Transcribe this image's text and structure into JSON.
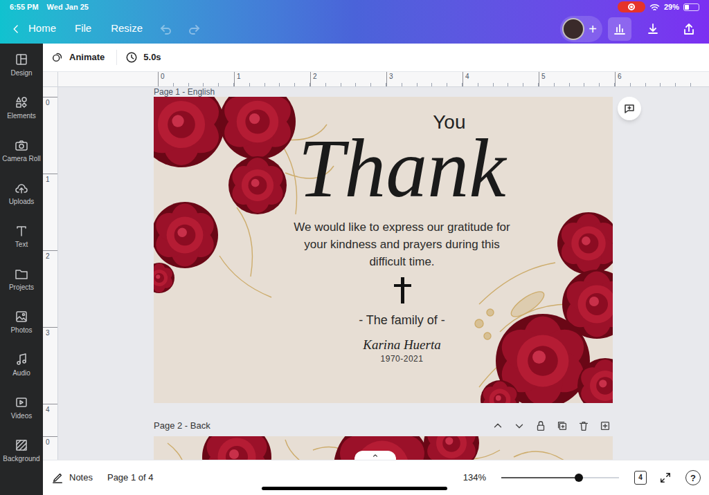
{
  "status_bar": {
    "time": "6:55 PM",
    "date": "Wed Jan 25",
    "recording": true,
    "battery": "29%",
    "battery_level": 0.29
  },
  "top_bar": {
    "back": "Home",
    "menu": [
      "File",
      "Resize"
    ],
    "undo": {
      "disabled": true
    },
    "redo": {
      "disabled": true
    },
    "add": "+",
    "actions": [
      {
        "kind": "insights",
        "selected": true
      },
      {
        "kind": "download",
        "selected": false
      },
      {
        "kind": "share",
        "selected": false
      }
    ]
  },
  "sidebar": {
    "items": [
      {
        "label": "Design"
      },
      {
        "label": "Elements"
      },
      {
        "label": "Camera Roll"
      },
      {
        "label": "Uploads"
      },
      {
        "label": "Text"
      },
      {
        "label": "Projects"
      },
      {
        "label": "Photos"
      },
      {
        "label": "Audio"
      },
      {
        "label": "Videos"
      },
      {
        "label": "Background"
      }
    ]
  },
  "toolbar": {
    "animate": "Animate",
    "duration": "5.0s"
  },
  "rulers": {
    "horizontal": [
      "0",
      "1",
      "2",
      "3",
      "4",
      "5",
      "6"
    ],
    "vertical": [
      "0",
      "1",
      "2",
      "3",
      "4",
      "0"
    ]
  },
  "pages": [
    {
      "label": "Page 1 - English",
      "design": {
        "title_small": "You",
        "title": "Thank",
        "message": [
          "We would like to express our gratitude for",
          "your kindness and prayers during this",
          "difficult time."
        ],
        "family_label": "- The family of -",
        "name": "Karina Huerta",
        "years": "1970-2021"
      }
    },
    {
      "label": "Page 2 - Back"
    }
  ],
  "bottom_bar": {
    "notes": "Notes",
    "page_indicator": "Page 1 of 4",
    "zoom": "134%",
    "zoom_level": 0.66,
    "page_count": "4",
    "help": "?"
  }
}
